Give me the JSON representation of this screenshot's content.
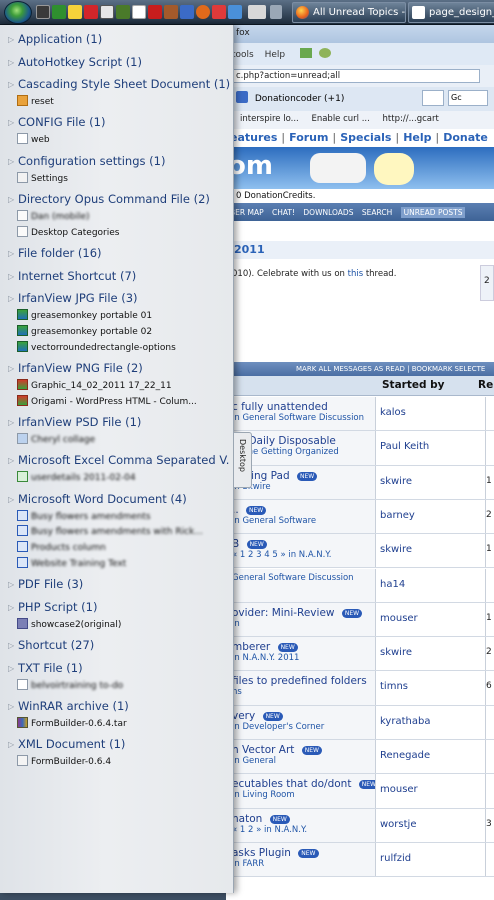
{
  "taskbar": {
    "tasks": [
      "All Unread Topics - ...",
      "page_design_w"
    ]
  },
  "browser": {
    "title_fragment": "fox",
    "menu": [
      "tools",
      "Help"
    ],
    "url": "c.php?action=unread;all",
    "tabs": [
      "Donationcoder (+1)"
    ],
    "bookmarks": [
      "interspire lo...",
      "Enable curl ...",
      "http://...gcart"
    ],
    "search_placeholder": "Gc",
    "site_nav": [
      "eatures",
      "|",
      "Forum",
      "|",
      "Specials",
      "|",
      "Help",
      "|",
      "Donate"
    ],
    "donation_text": "0 DonationCredits.",
    "nav_items": [
      "BER MAP",
      "CHAT!",
      "DOWNLOADS",
      "SEARCH",
      "UNREAD POSTS"
    ],
    "year_text": "2011",
    "celebrate_pre": "010). Celebrate with us on ",
    "celebrate_link": "this",
    "celebrate_post": " thread.",
    "side_number": "2",
    "mark_bar": "MARK ALL MESSAGES AS READ  |  BOOKMARK SELECTE",
    "header_started": "Started by",
    "header_rep": "Rep",
    "new_badge": "NEW",
    "rows": [
      {
        "title": "c fully unattended",
        "sub": "in General Software Discussion",
        "starter": "kalos",
        "rep": ""
      },
      {
        "title": "ed Daily Disposable",
        "sub": "in The Getting Organized",
        "starter": "Paul Keith",
        "rep": ""
      },
      {
        "title": "nching Pad",
        "sub": "in Skwire",
        "starter": "skwire",
        "rep": "1"
      },
      {
        "title": "..",
        "sub": "in General Software",
        "starter": "barney",
        "rep": "2"
      },
      {
        "title": "B",
        "sub": "« 1 2 3 4 5 » in N.A.N.Y.",
        "starter": "skwire",
        "rep": "1"
      },
      {
        "title": "",
        "sub": "General Software Discussion",
        "starter": "ha14",
        "rep": ""
      },
      {
        "title": "ovider: Mini-Review",
        "sub": "in",
        "starter": "mouser",
        "rep": "1"
      },
      {
        "title": "mberer",
        "sub": "in N.A.N.Y. 2011",
        "starter": "skwire",
        "rep": "2"
      },
      {
        "title": "files to predefined folders",
        "sub": "ns",
        "starter": "timns",
        "rep": "6"
      },
      {
        "title": "very",
        "sub": "in Developer's Corner",
        "starter": "kyrathaba",
        "rep": ""
      },
      {
        "title": "n Vector Art",
        "sub": "in General",
        "starter": "Renegade",
        "rep": ""
      },
      {
        "title": "ecutables that do/dont",
        "sub": "in Living Room",
        "starter": "mouser",
        "rep": ""
      },
      {
        "title": "naton",
        "sub": "« 1 2 » in N.A.N.Y.",
        "starter": "worstje",
        "rep": "3"
      },
      {
        "title": "asks Plugin",
        "sub": "in FARR",
        "starter": "rulfzid",
        "rep": ""
      }
    ]
  },
  "jumplist": {
    "desktop_tab": "Desktop",
    "groups": [
      {
        "name": "Application (1)",
        "items": []
      },
      {
        "name": "AutoHotkey Script (1)",
        "items": []
      },
      {
        "name": "Cascading Style Sheet Document (1)",
        "items": [
          {
            "label": "reset",
            "icon": "css-file-icon"
          }
        ]
      },
      {
        "name": "CONFIG File (1)",
        "items": [
          {
            "label": "web",
            "icon": "config-file-icon"
          }
        ]
      },
      {
        "name": "Configuration settings (1)",
        "items": [
          {
            "label": "Settings",
            "icon": "settings-file-icon"
          }
        ]
      },
      {
        "name": "Directory Opus Command File (2)",
        "items": [
          {
            "label": "Dan (mobile)",
            "icon": "opus-file-icon",
            "blur": true
          },
          {
            "label": "Desktop Categories",
            "icon": "opus-file-icon"
          }
        ]
      },
      {
        "name": "File folder (16)",
        "items": []
      },
      {
        "name": "Internet Shortcut (7)",
        "items": []
      },
      {
        "name": "IrfanView JPG File (3)",
        "items": [
          {
            "label": "greasemonkey portable 01",
            "icon": "jpg-file-icon"
          },
          {
            "label": "greasemonkey portable 02",
            "icon": "jpg-file-icon"
          },
          {
            "label": "vectorroundedrectangle-options",
            "icon": "jpg-file-icon"
          }
        ]
      },
      {
        "name": "IrfanView PNG File (2)",
        "items": [
          {
            "label": "Graphic_14_02_2011 17_22_11",
            "icon": "png-file-icon"
          },
          {
            "label": "Origami - WordPress HTML - Colum...",
            "icon": "png-file-icon"
          }
        ]
      },
      {
        "name": "IrfanView PSD File (1)",
        "items": [
          {
            "label": "Cheryl collage",
            "icon": "psd-file-icon",
            "blur": true
          }
        ]
      },
      {
        "name": "Microsoft Excel Comma Separated V... (1)",
        "items": [
          {
            "label": "userdetails 2011-02-04",
            "icon": "csv-file-icon",
            "blur": true
          }
        ]
      },
      {
        "name": "Microsoft Word Document (4)",
        "items": [
          {
            "label": "Busy flowers amendments",
            "icon": "doc-file-icon",
            "blur": true
          },
          {
            "label": "Busy flowers amendments with Rick...",
            "icon": "doc-file-icon",
            "blur": true
          },
          {
            "label": "Products column",
            "icon": "doc-file-icon",
            "blur": true
          },
          {
            "label": "Website Training Text",
            "icon": "doc-file-icon",
            "blur": true
          }
        ]
      },
      {
        "name": "PDF File (3)",
        "items": []
      },
      {
        "name": "PHP Script (1)",
        "items": [
          {
            "label": "showcase2(original)",
            "icon": "php-file-icon"
          }
        ]
      },
      {
        "name": "Shortcut (27)",
        "items": []
      },
      {
        "name": "TXT File (1)",
        "items": [
          {
            "label": "belvoirtraining to-do",
            "icon": "txt-file-icon",
            "blur": true
          }
        ]
      },
      {
        "name": "WinRAR archive (1)",
        "items": [
          {
            "label": "FormBuilder-0.6.4.tar",
            "icon": "rar-file-icon"
          }
        ]
      },
      {
        "name": "XML Document (1)",
        "items": [
          {
            "label": "FormBuilder-0.6.4",
            "icon": "xml-file-icon"
          }
        ]
      }
    ]
  }
}
